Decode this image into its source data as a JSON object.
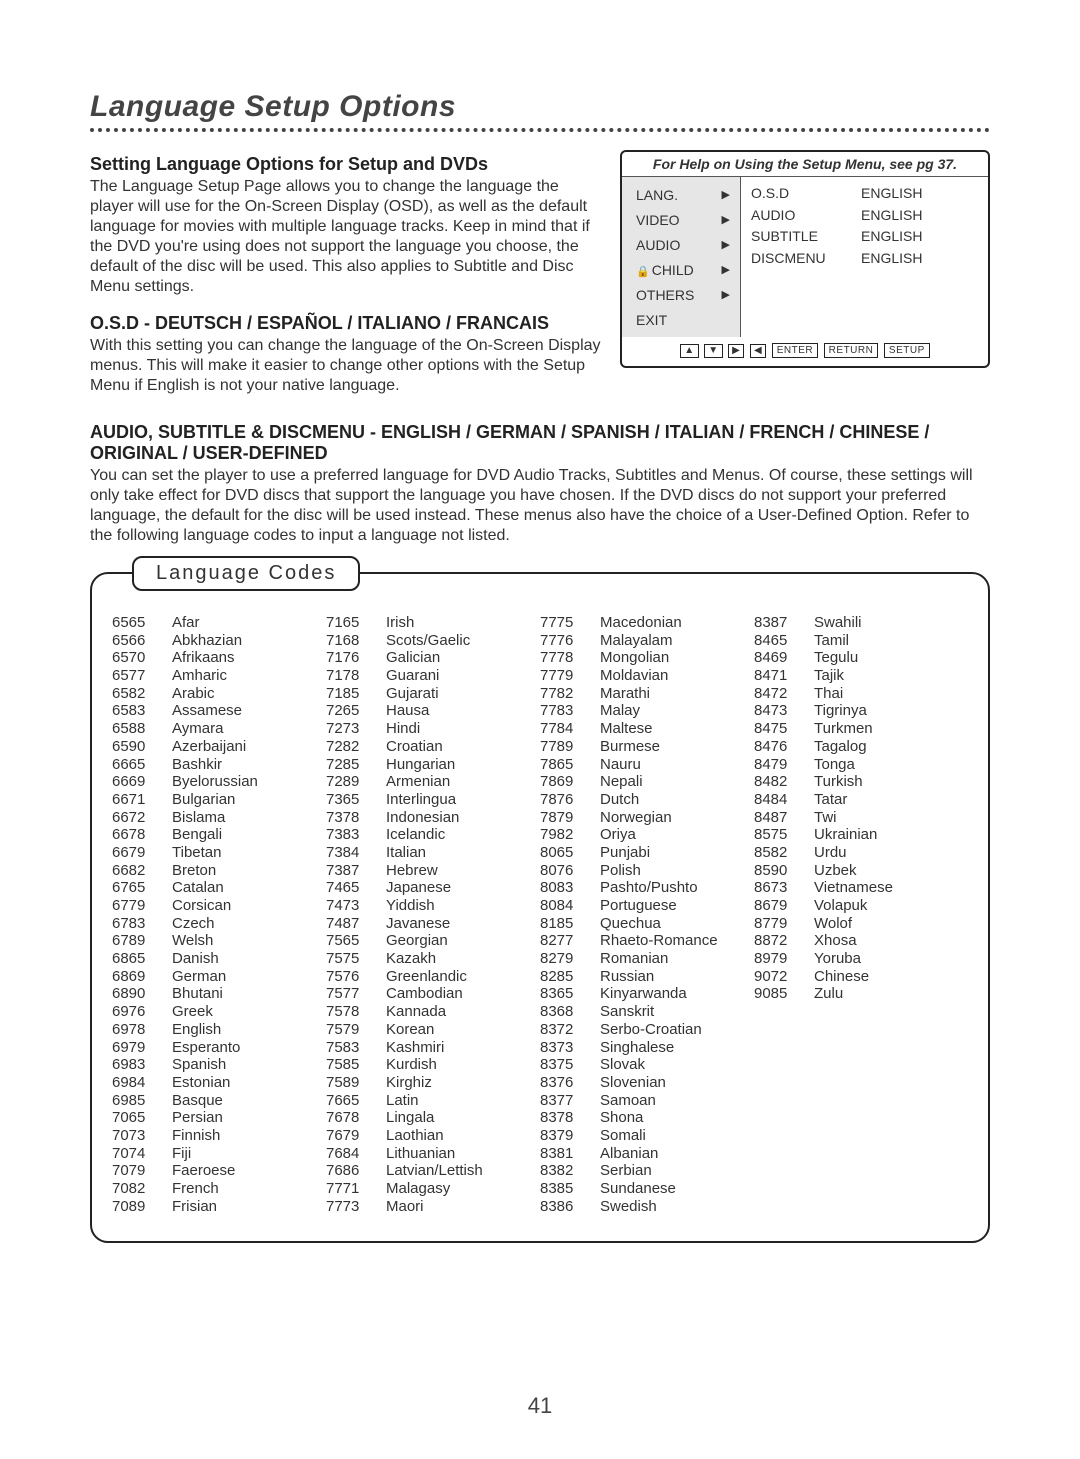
{
  "title": "Language Setup Options",
  "sections": {
    "s1": {
      "heading": "Setting Language Options for Setup and DVDs",
      "body": "The Language Setup Page allows you to change the language the player will use for the On-Screen Display (OSD), as well as the default language for movies with multiple language tracks. Keep in mind that if the DVD you're using does not support the language you choose, the default of the disc will be used. This also applies to Subtitle and Disc Menu settings."
    },
    "s2": {
      "heading": "O.S.D - DEUTSCH / ESPAÑOL / ITALIANO / FRANCAIS",
      "body": "With this setting you can change the language of the On-Screen Display menus. This will make it easier to change other options with the Setup Menu if English is not your native language."
    },
    "s3": {
      "heading": "AUDIO, SUBTITLE & DISCMENU - ENGLISH / GERMAN / SPANISH / ITALIAN / FRENCH / CHINESE / ORIGINAL / USER-DEFINED",
      "body": "You can set the player to use a preferred language for DVD Audio Tracks, Subtitles and Menus. Of course, these settings will only take effect for DVD discs that support the language you have chosen. If the DVD discs do not support your preferred language, the default for the disc will be used instead. These menus also have the choice of a User-Defined Option. Refer to the following language codes to input a language not listed."
    }
  },
  "panel": {
    "help": "For Help on Using the Setup Menu, see pg 37.",
    "left": [
      "LANG.",
      "VIDEO",
      "AUDIO",
      "CHILD",
      "OTHERS",
      "EXIT"
    ],
    "right": [
      {
        "k": "O.S.D",
        "v": "ENGLISH"
      },
      {
        "k": "AUDIO",
        "v": "ENGLISH"
      },
      {
        "k": "SUBTITLE",
        "v": "ENGLISH"
      },
      {
        "k": "DISCMENU",
        "v": "ENGLISH"
      }
    ],
    "footer_keys": [
      "▲",
      "▼",
      "▶",
      "◀"
    ],
    "footer_btns": [
      "ENTER",
      "RETURN",
      "SETUP"
    ]
  },
  "codes_title": "Language Codes",
  "codes": {
    "col1": [
      [
        "6565",
        "Afar"
      ],
      [
        "6566",
        "Abkhazian"
      ],
      [
        "6570",
        "Afrikaans"
      ],
      [
        "6577",
        "Amharic"
      ],
      [
        "6582",
        "Arabic"
      ],
      [
        "6583",
        "Assamese"
      ],
      [
        "6588",
        "Aymara"
      ],
      [
        "6590",
        "Azerbaijani"
      ],
      [
        "6665",
        "Bashkir"
      ],
      [
        "6669",
        "Byelorussian"
      ],
      [
        "6671",
        "Bulgarian"
      ],
      [
        "6672",
        "Bislama"
      ],
      [
        "6678",
        "Bengali"
      ],
      [
        "6679",
        "Tibetan"
      ],
      [
        "6682",
        "Breton"
      ],
      [
        "6765",
        "Catalan"
      ],
      [
        "6779",
        "Corsican"
      ],
      [
        "6783",
        "Czech"
      ],
      [
        "6789",
        "Welsh"
      ],
      [
        "6865",
        "Danish"
      ],
      [
        "6869",
        "German"
      ],
      [
        "6890",
        "Bhutani"
      ],
      [
        "6976",
        "Greek"
      ],
      [
        "6978",
        "English"
      ],
      [
        "6979",
        "Esperanto"
      ],
      [
        "6983",
        "Spanish"
      ],
      [
        "6984",
        "Estonian"
      ],
      [
        "6985",
        "Basque"
      ],
      [
        "7065",
        "Persian"
      ],
      [
        "7073",
        "Finnish"
      ],
      [
        "7074",
        "Fiji"
      ],
      [
        "7079",
        "Faeroese"
      ],
      [
        "7082",
        "French"
      ],
      [
        "7089",
        "Frisian"
      ]
    ],
    "col2": [
      [
        "7165",
        "Irish"
      ],
      [
        "7168",
        "Scots/Gaelic"
      ],
      [
        "7176",
        "Galician"
      ],
      [
        "7178",
        "Guarani"
      ],
      [
        "7185",
        "Gujarati"
      ],
      [
        "7265",
        "Hausa"
      ],
      [
        "7273",
        "Hindi"
      ],
      [
        "7282",
        "Croatian"
      ],
      [
        "7285",
        "Hungarian"
      ],
      [
        "7289",
        "Armenian"
      ],
      [
        "7365",
        "Interlingua"
      ],
      [
        "7378",
        "Indonesian"
      ],
      [
        "7383",
        "Icelandic"
      ],
      [
        "7384",
        "Italian"
      ],
      [
        "7387",
        "Hebrew"
      ],
      [
        "7465",
        "Japanese"
      ],
      [
        "7473",
        "Yiddish"
      ],
      [
        "7487",
        "Javanese"
      ],
      [
        "7565",
        "Georgian"
      ],
      [
        "7575",
        "Kazakh"
      ],
      [
        "7576",
        "Greenlandic"
      ],
      [
        "7577",
        "Cambodian"
      ],
      [
        "7578",
        "Kannada"
      ],
      [
        "7579",
        "Korean"
      ],
      [
        "7583",
        "Kashmiri"
      ],
      [
        "7585",
        "Kurdish"
      ],
      [
        "7589",
        "Kirghiz"
      ],
      [
        "7665",
        "Latin"
      ],
      [
        "7678",
        "Lingala"
      ],
      [
        "7679",
        "Laothian"
      ],
      [
        "7684",
        "Lithuanian"
      ],
      [
        "7686",
        "Latvian/Lettish"
      ],
      [
        "7771",
        "Malagasy"
      ],
      [
        "7773",
        "Maori"
      ]
    ],
    "col3": [
      [
        "7775",
        "Macedonian"
      ],
      [
        "7776",
        "Malayalam"
      ],
      [
        "7778",
        "Mongolian"
      ],
      [
        "7779",
        "Moldavian"
      ],
      [
        "7782",
        "Marathi"
      ],
      [
        "7783",
        "Malay"
      ],
      [
        "7784",
        "Maltese"
      ],
      [
        "7789",
        "Burmese"
      ],
      [
        "7865",
        "Nauru"
      ],
      [
        "7869",
        "Nepali"
      ],
      [
        "7876",
        "Dutch"
      ],
      [
        "7879",
        "Norwegian"
      ],
      [
        "7982",
        "Oriya"
      ],
      [
        "8065",
        "Punjabi"
      ],
      [
        "8076",
        "Polish"
      ],
      [
        "8083",
        "Pashto/Pushto"
      ],
      [
        "8084",
        "Portuguese"
      ],
      [
        "8185",
        "Quechua"
      ],
      [
        "8277",
        "Rhaeto-Romance"
      ],
      [
        "8279",
        "Romanian"
      ],
      [
        "8285",
        "Russian"
      ],
      [
        "8365",
        "Kinyarwanda"
      ],
      [
        "8368",
        "Sanskrit"
      ],
      [
        "8372",
        "Serbo-Croatian"
      ],
      [
        "8373",
        "Singhalese"
      ],
      [
        "8375",
        "Slovak"
      ],
      [
        "8376",
        "Slovenian"
      ],
      [
        "8377",
        "Samoan"
      ],
      [
        "8378",
        "Shona"
      ],
      [
        "8379",
        "Somali"
      ],
      [
        "8381",
        "Albanian"
      ],
      [
        "8382",
        "Serbian"
      ],
      [
        "8385",
        "Sundanese"
      ],
      [
        "8386",
        "Swedish"
      ]
    ],
    "col4": [
      [
        "8387",
        "Swahili"
      ],
      [
        "8465",
        "Tamil"
      ],
      [
        "8469",
        "Tegulu"
      ],
      [
        "8471",
        "Tajik"
      ],
      [
        "8472",
        "Thai"
      ],
      [
        "8473",
        "Tigrinya"
      ],
      [
        "8475",
        "Turkmen"
      ],
      [
        "8476",
        "Tagalog"
      ],
      [
        "8479",
        "Tonga"
      ],
      [
        "8482",
        "Turkish"
      ],
      [
        "8484",
        "Tatar"
      ],
      [
        "8487",
        "Twi"
      ],
      [
        "8575",
        "Ukrainian"
      ],
      [
        "8582",
        "Urdu"
      ],
      [
        "8590",
        "Uzbek"
      ],
      [
        "8673",
        "Vietnamese"
      ],
      [
        "8679",
        "Volapuk"
      ],
      [
        "8779",
        "Wolof"
      ],
      [
        "8872",
        "Xhosa"
      ],
      [
        "8979",
        "Yoruba"
      ],
      [
        "9072",
        "Chinese"
      ],
      [
        "9085",
        "Zulu"
      ]
    ]
  },
  "page_number": "41"
}
